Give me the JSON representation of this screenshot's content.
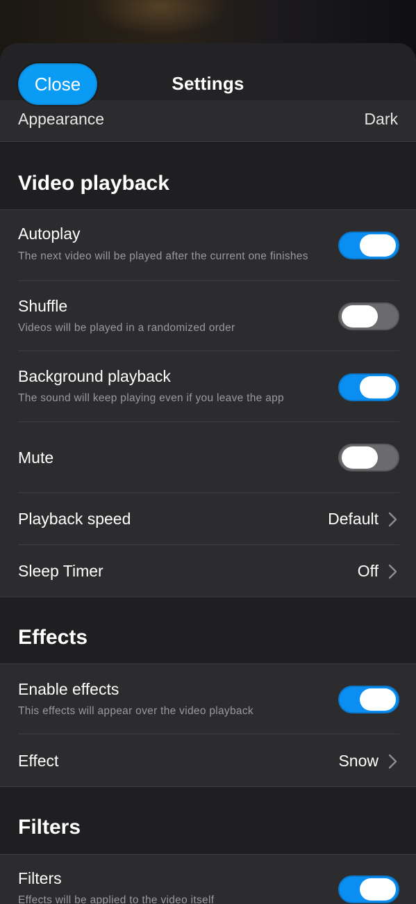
{
  "header": {
    "close_label": "Close",
    "title": "Settings"
  },
  "appearance": {
    "label": "Appearance",
    "value": "Dark"
  },
  "sections": {
    "video_playback": {
      "title": "Video playback",
      "autoplay": {
        "label": "Autoplay",
        "subtitle": "The next video will be played after the current one finishes",
        "enabled": true
      },
      "shuffle": {
        "label": "Shuffle",
        "subtitle": "Videos will be played in a randomized order",
        "enabled": false
      },
      "background": {
        "label": "Background playback",
        "subtitle": "The sound will keep playing even if you leave the app",
        "enabled": true
      },
      "mute": {
        "label": "Mute",
        "enabled": false
      },
      "speed": {
        "label": "Playback speed",
        "value": "Default"
      },
      "sleep": {
        "label": "Sleep Timer",
        "value": "Off"
      }
    },
    "effects": {
      "title": "Effects",
      "enable": {
        "label": "Enable effects",
        "subtitle": "This effects will appear over the video playback",
        "enabled": true
      },
      "effect": {
        "label": "Effect",
        "value": "Snow"
      }
    },
    "filters": {
      "title": "Filters",
      "filters": {
        "label": "Filters",
        "subtitle": "Effects will be applied to the video itself",
        "enabled": true
      }
    }
  },
  "colors": {
    "accent": "#0a9cf5",
    "toggle_on": "#0a8ef2",
    "toggle_off": "#6b6b6e",
    "row_bg": "#2c2c2e",
    "section_bg": "#1f1f21"
  },
  "icons": [
    "chevron-right-icon"
  ]
}
